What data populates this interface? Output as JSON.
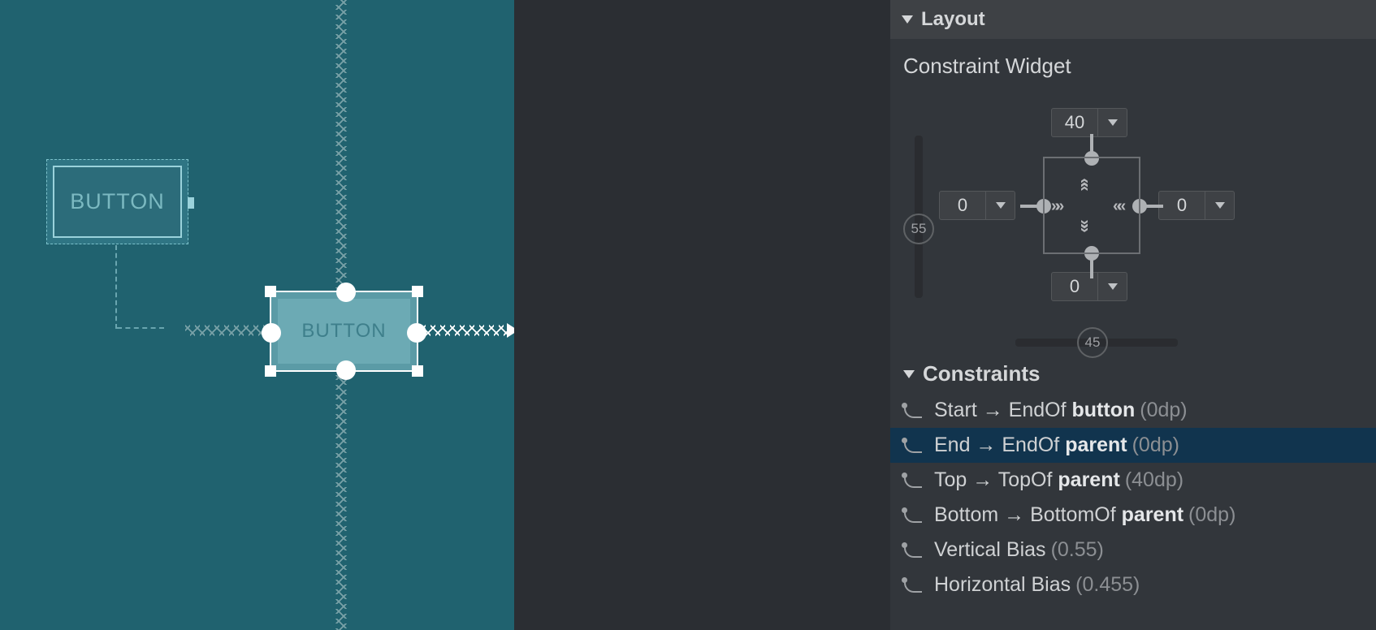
{
  "canvas": {
    "button1_label": "BUTTON",
    "button2_label": "BUTTON"
  },
  "panel": {
    "section_title": "Layout",
    "constraint_widget_label": "Constraint Widget",
    "margins": {
      "top": "40",
      "bottom": "0",
      "start": "0",
      "end": "0"
    },
    "vbias_display": "55",
    "hbias_display": "45",
    "constraints_title": "Constraints",
    "rows": [
      {
        "text_a": "Start → EndOf ",
        "bold": "button",
        "dp": "(0dp)"
      },
      {
        "text_a": "End → EndOf ",
        "bold": "parent",
        "dp": "(0dp)"
      },
      {
        "text_a": "Top → TopOf ",
        "bold": "parent",
        "dp": "(40dp)"
      },
      {
        "text_a": "Bottom → BottomOf ",
        "bold": "parent",
        "dp": "(0dp)"
      },
      {
        "text_a": "Vertical Bias",
        "bold": "",
        "dp": "(0.55)"
      },
      {
        "text_a": "Horizontal Bias",
        "bold": "",
        "dp": "(0.455)"
      }
    ]
  }
}
